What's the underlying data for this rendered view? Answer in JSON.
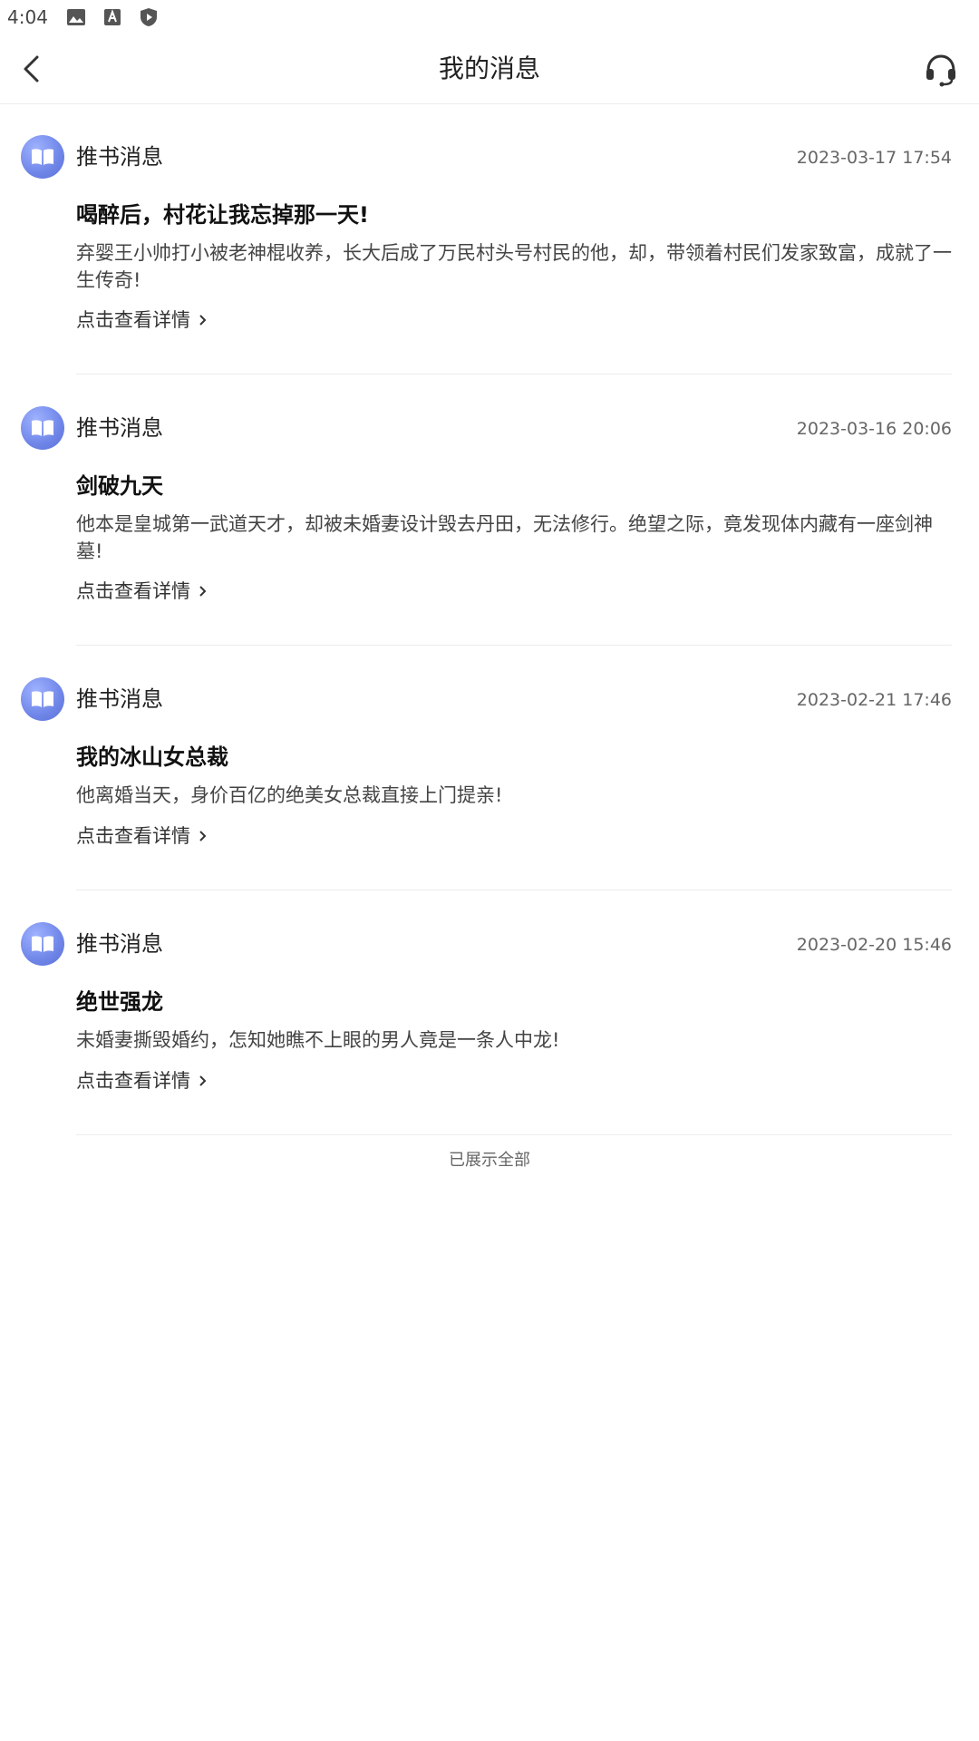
{
  "status_bar": {
    "time": "4:04",
    "icons": [
      "image-icon",
      "text-a-icon",
      "shield-play-icon"
    ]
  },
  "header": {
    "title": "我的消息",
    "back_icon": "back-arrow-icon",
    "support_icon": "headset-icon"
  },
  "messages": [
    {
      "type": "推书消息",
      "time": "2023-03-17 17:54",
      "title": "喝醉后，村花让我忘掉那一天!",
      "desc": "弃婴王小帅打小被老神棍收养，长大后成了万民村头号村民的他，却，带领着村民们发家致富，成就了一生传奇!",
      "link": "点击查看详情"
    },
    {
      "type": "推书消息",
      "time": "2023-03-16 20:06",
      "title": "剑破九天",
      "desc": "他本是皇城第一武道天才，却被未婚妻设计毁去丹田，无法修行。绝望之际，竟发现体内藏有一座剑神墓!",
      "link": "点击查看详情"
    },
    {
      "type": "推书消息",
      "time": "2023-02-21 17:46",
      "title": "我的冰山女总裁",
      "desc": "他离婚当天，身价百亿的绝美女总裁直接上门提亲!",
      "link": "点击查看详情"
    },
    {
      "type": "推书消息",
      "time": "2023-02-20 15:46",
      "title": "绝世强龙",
      "desc": "未婚妻撕毁婚约，怎知她瞧不上眼的男人竟是一条人中龙!",
      "link": "点击查看详情"
    }
  ],
  "footer": {
    "text": "已展示全部"
  },
  "colors": {
    "avatar": "#6f86e8",
    "divider": "#ececec"
  }
}
